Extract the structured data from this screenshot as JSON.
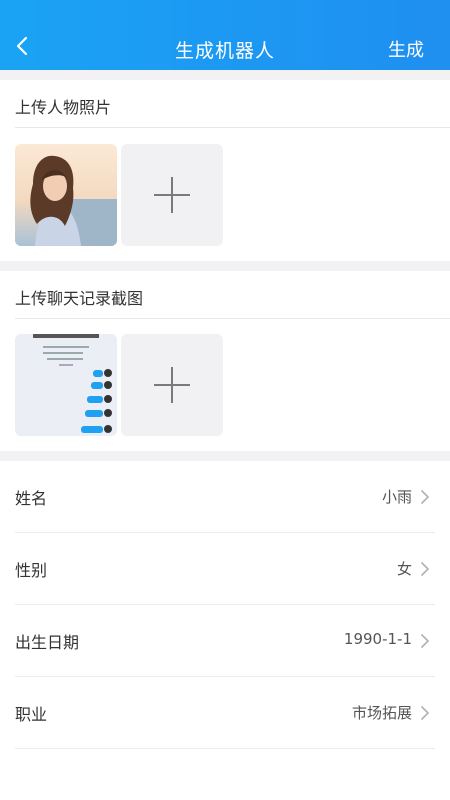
{
  "header": {
    "title": "生成机器人",
    "action_label": "生成",
    "background": "#1f8ff0"
  },
  "photo_section": {
    "title": "上传人物照片"
  },
  "chat_section": {
    "title": "上传聊天记录截图"
  },
  "form_rows": [
    {
      "label": "姓名",
      "value": "小雨"
    },
    {
      "label": "性别",
      "value": "女"
    },
    {
      "label": "出生日期",
      "value": "1990-1-1"
    },
    {
      "label": "职业",
      "value": "市场拓展"
    }
  ],
  "icons": [
    "back-icon",
    "plus-icon",
    "chevron-right-icon"
  ]
}
